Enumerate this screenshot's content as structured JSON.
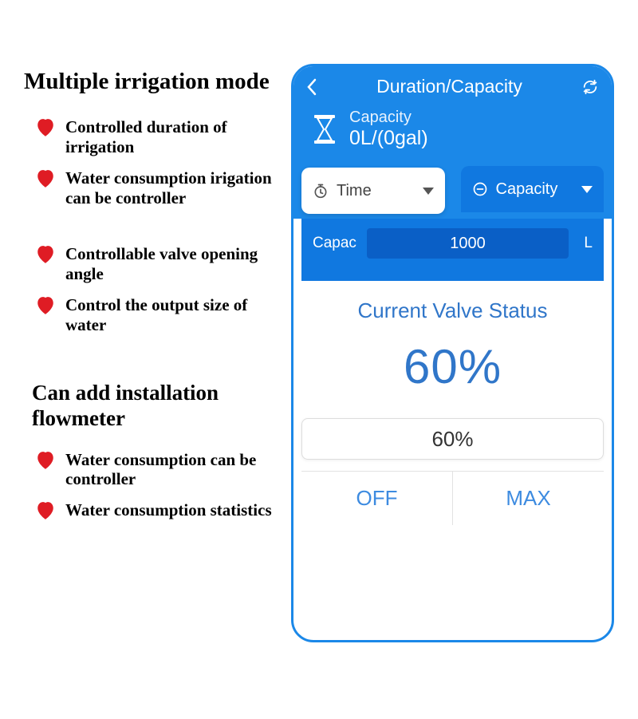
{
  "left": {
    "heading_modes": "Multiple irrigation mode",
    "bullets_modes": [
      "Controlled duration of irrigation",
      "Water consumption irigation can be controller",
      "Controllable valve opening angle",
      "Control the output size of water"
    ],
    "heading_flowmeter": "Can add installation flowmeter",
    "bullets_flowmeter": [
      "Water consumption can be controller",
      "Water consumption statistics"
    ]
  },
  "phone": {
    "title": "Duration/Capacity",
    "capacity_label": "Capacity",
    "capacity_value": "0L/(0gal)",
    "tabs": {
      "time_label": "Time",
      "capacity_label": "Capacity"
    },
    "input": {
      "label": "Capac",
      "value": "1000",
      "unit": "L"
    },
    "status_title": "Current Valve Status",
    "status_percent": "60%",
    "slider_value": "60%",
    "off_label": "OFF",
    "max_label": "MAX"
  },
  "colors": {
    "primary": "#1b88e8",
    "heart": "#df1c24"
  }
}
